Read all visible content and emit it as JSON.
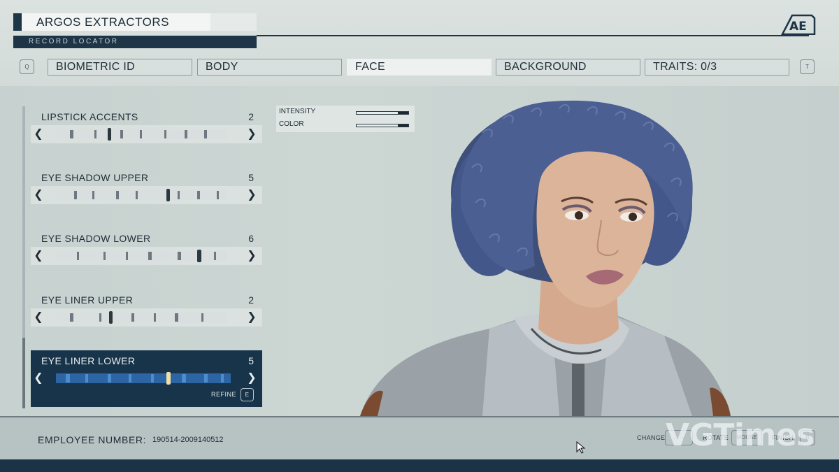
{
  "header": {
    "company_name": "ARGOS EXTRACTORS",
    "record_locator": "RECORD LOCATOR",
    "logo_text": "AE",
    "left_key": "Q",
    "right_key": "T",
    "tabs": [
      {
        "label": "BIOMETRIC ID",
        "active": false
      },
      {
        "label": "BODY",
        "active": false
      },
      {
        "label": "FACE",
        "active": true
      },
      {
        "label": "BACKGROUND",
        "active": false
      },
      {
        "label": "TRAITS: 0/3",
        "active": false
      }
    ]
  },
  "sliders": [
    {
      "label": "LIPSTICK ACCENTS",
      "value": "2",
      "selected": false
    },
    {
      "label": "EYE SHADOW UPPER",
      "value": "5",
      "selected": false
    },
    {
      "label": "EYE SHADOW LOWER",
      "value": "6",
      "selected": false
    },
    {
      "label": "EYE LINER UPPER",
      "value": "2",
      "selected": false
    },
    {
      "label": "EYE LINER LOWER",
      "value": "5",
      "selected": true
    }
  ],
  "refine": {
    "label": "REFINE",
    "key": "E"
  },
  "adjust": {
    "intensity_label": "INTENSITY",
    "intensity_level": 0.88,
    "color_label": "COLOR",
    "color_level": 0.88
  },
  "footer": {
    "employee_label": "EMPLOYEE NUMBER:",
    "employee_number": "190514-2009140512",
    "change_label": "CHANGE",
    "change_key": "← →",
    "rotate_label": "ROTATE",
    "rotate_key": "MOUSE",
    "finish_label": "FINISH",
    "finish_key": "R"
  },
  "watermark": "VGTimes",
  "colors": {
    "navy": "#18344a",
    "panel": "#dbe2e0",
    "hair": "#4a5f8a"
  }
}
